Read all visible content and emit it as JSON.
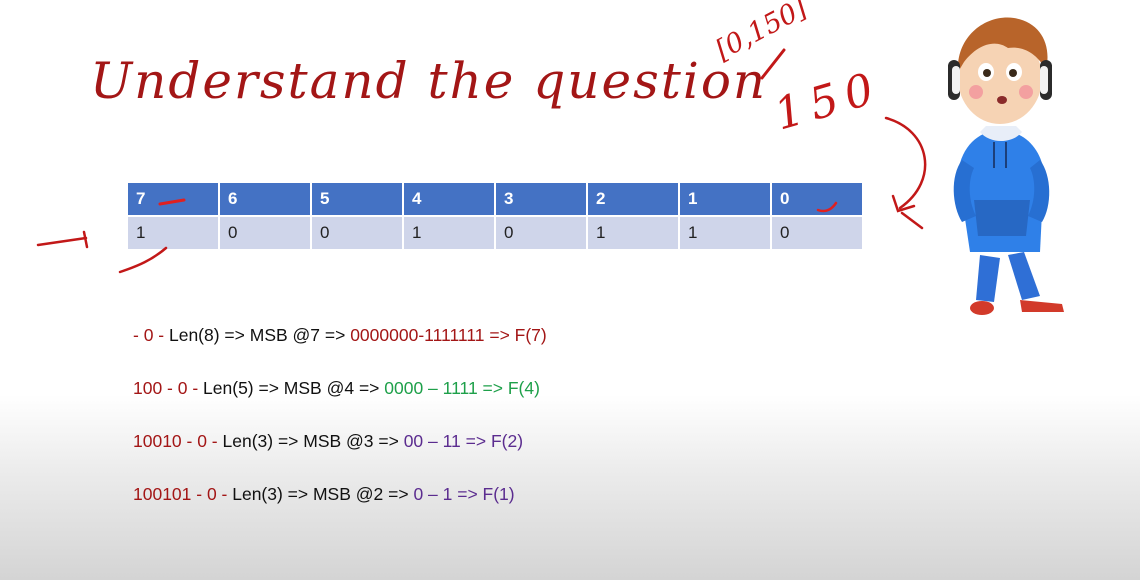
{
  "title": "Understand the question",
  "table": {
    "positions": [
      "7",
      "6",
      "5",
      "4",
      "3",
      "2",
      "1",
      "0"
    ],
    "bits": [
      "1",
      "0",
      "0",
      "1",
      "0",
      "1",
      "1",
      "0"
    ]
  },
  "lines": [
    {
      "prefix": "- 0 -",
      "middle": " Len(8) => MSB @7 => ",
      "range": "0000000-1111111",
      "result": " => F(7)",
      "accent": "#a31616"
    },
    {
      "prefix": "100 - 0 -",
      "middle": " Len(5) => MSB @4 => ",
      "range": "0000 – 1111",
      "result": " => F(4)",
      "accent": "#1ea04a"
    },
    {
      "prefix": "10010 - 0 -",
      "middle": " Len(3) => MSB @3 => ",
      "range": "00 – 11",
      "result": " => F(2)",
      "accent": "#5b2c8f"
    },
    {
      "prefix": "100101 - 0 - ",
      "middle": " Len(3) => MSB @2 => ",
      "range": "0 – 1",
      "result": " => F(1)",
      "accent": "#5b2c8f"
    }
  ],
  "annotations": {
    "range_note": "[0,150]",
    "value_note": "150"
  },
  "colors": {
    "title": "#a31616",
    "header": "#4472c4",
    "row": "#cfd5ea",
    "ink": "#c21818"
  }
}
